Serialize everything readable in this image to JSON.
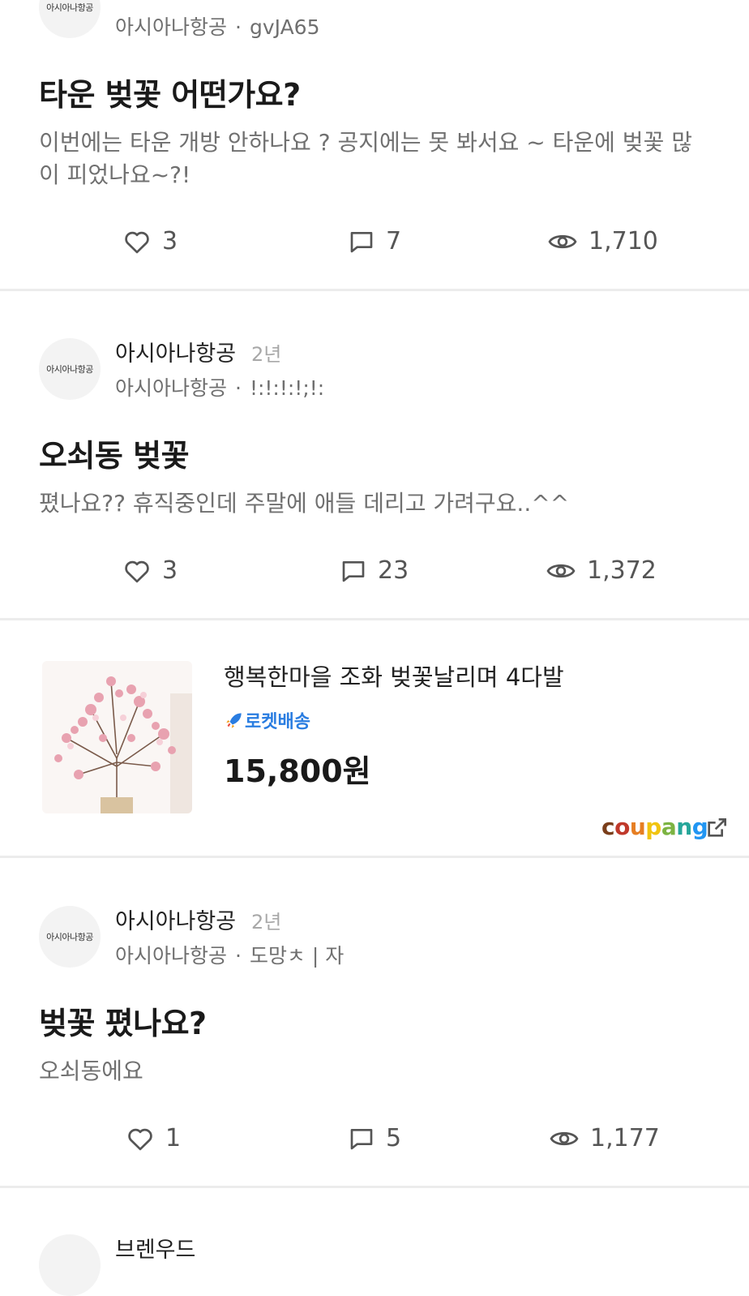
{
  "posts": [
    {
      "avatar_text": "아시아나항공",
      "author": "",
      "age": "",
      "sub_org": "아시아나항공",
      "sub_nick": "gvJA65",
      "title": "타운 벚꽃 어떤가요?",
      "body": "이번에는 타운 개방 안하나요 ?  공지에는 못 봐서요 ~  타운에 벚꽃 많이 피었나요~?!",
      "likes": "3",
      "comments": "7",
      "views": "1,710"
    },
    {
      "avatar_text": "아시아나항공",
      "author": "아시아나항공",
      "age": "2년",
      "sub_org": "아시아나항공",
      "sub_nick": "!:!:!:!;!:",
      "title": "오쇠동 벚꽃",
      "body": "폈나요??  휴직중인데 주말에 애들 데리고 가려구요..^^",
      "likes": "3",
      "comments": "23",
      "views": "1,372"
    },
    {
      "avatar_text": "아시아나항공",
      "author": "아시아나항공",
      "age": "2년",
      "sub_org": "아시아나항공",
      "sub_nick": "도망ㅊ | 자",
      "title": "벚꽃 폈나요?",
      "body": "오쇠동에요",
      "likes": "1",
      "comments": "5",
      "views": "1,177"
    },
    {
      "author": "브렌우드"
    }
  ],
  "ad": {
    "title": "행복한마을 조화 벚꽃날리며 4다발",
    "badge": "로켓배송",
    "price": "15,800원",
    "brand_letters": [
      "c",
      "o",
      "u",
      "p",
      "a",
      "n",
      "g"
    ],
    "brand_colors": [
      "#7a3e1a",
      "#c0392b",
      "#e67e22",
      "#f1c40f",
      "#7cb342",
      "#26a69a",
      "#2196f3"
    ]
  },
  "colors": {
    "separator": "#ececec",
    "badge_blue": "#2a7de1",
    "muted_text": "#707070"
  }
}
